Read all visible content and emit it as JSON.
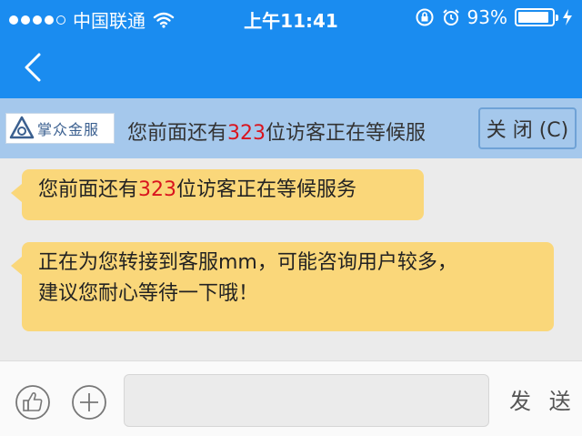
{
  "status_bar": {
    "carrier": "中国联通",
    "time": "上午11:41",
    "battery": "93%",
    "battery_level": 0.93
  },
  "notice": {
    "logo_text": "掌众金服",
    "prefix": "您前面还有",
    "count": "323",
    "suffix": "位访客正在等候服",
    "close_label": "关 闭 (C)"
  },
  "messages": [
    {
      "prefix": "您前面还有",
      "count": "323",
      "suffix": "位访客正在等候服务"
    },
    {
      "line1": "正在为您转接到客服mm，可能咨询用户较多，",
      "line2": "建议您耐心等待一下哦！"
    }
  ],
  "input_bar": {
    "placeholder": "",
    "send_label": "发 送"
  },
  "colors": {
    "primary": "#1a8cf0",
    "notice_bg": "#a5c8ec",
    "bubble": "#fad77a",
    "highlight": "#d9141e"
  }
}
